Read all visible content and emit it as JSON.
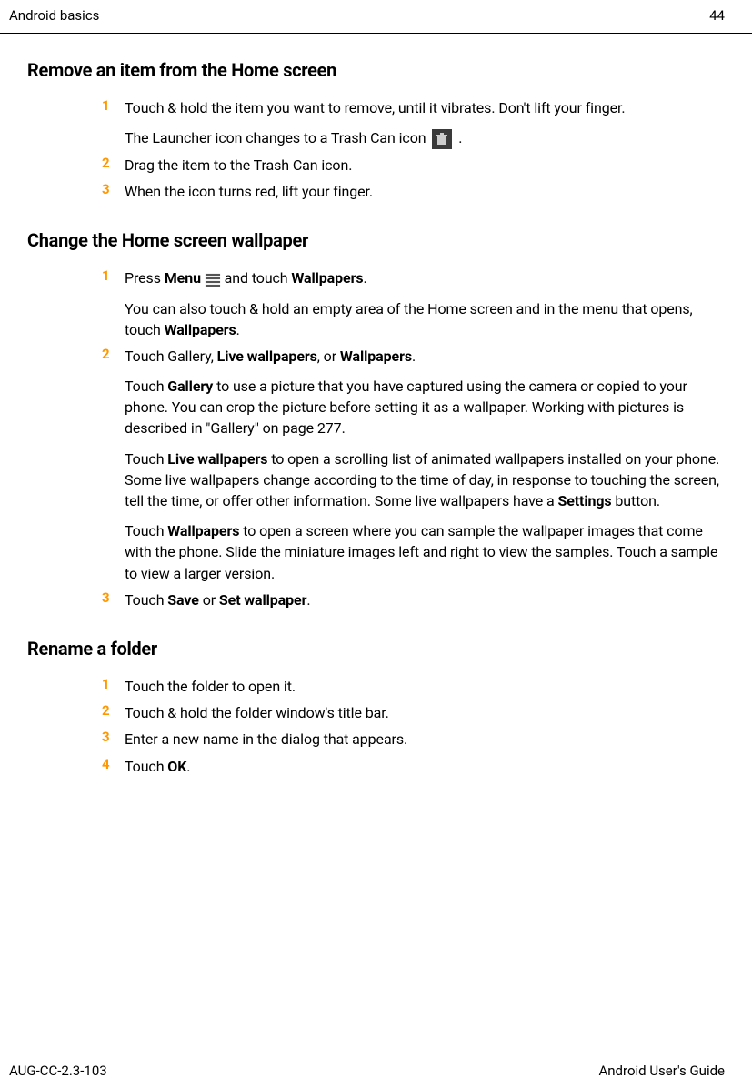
{
  "header": {
    "left": "Android basics",
    "right": "44"
  },
  "section1": {
    "title": "Remove an item from the Home screen",
    "steps": [
      {
        "num": "1",
        "line1": "Touch & hold the item you want to remove, until it vibrates. Don't lift your finger.",
        "line2a": "The Launcher icon changes to a Trash Can icon ",
        "line2b": " ."
      },
      {
        "num": "2",
        "text": "Drag the item to the Trash Can icon."
      },
      {
        "num": "3",
        "text": "When the icon turns red, lift your finger."
      }
    ]
  },
  "section2": {
    "title": "Change the Home screen wallpaper",
    "step1": {
      "num": "1",
      "p1_a": "Press ",
      "p1_b": "Menu",
      "p1_c": " ",
      "p1_d": " and touch ",
      "p1_e": "Wallpapers",
      "p1_f": ".",
      "p2_a": "You can also touch & hold an empty area of the Home screen and in the menu that opens, touch ",
      "p2_b": "Wallpapers",
      "p2_c": "."
    },
    "step2": {
      "num": "2",
      "p1_a": "Touch Gallery, ",
      "p1_b": "Live wallpapers",
      "p1_c": ", or ",
      "p1_d": "Wallpapers",
      "p1_e": ".",
      "p2_a": "Touch ",
      "p2_b": "Gallery",
      "p2_c": " to use a picture that you have captured using the camera or copied to your phone. You can crop the picture before setting it as a wallpaper. Working with pictures is described in \"Gallery\" on page 277.",
      "p3_a": "Touch ",
      "p3_b": "Live wallpapers",
      "p3_c": " to open a scrolling list of animated wallpapers installed on your phone. Some live wallpapers change according to the time of day, in response to touching the screen, tell the time, or offer other information. Some live wallpapers have a ",
      "p3_d": "Settings",
      "p3_e": " button.",
      "p4_a": "Touch ",
      "p4_b": "Wallpapers",
      "p4_c": " to open a screen where you can sample the wallpaper images that come with the phone. Slide the miniature images left and right to view the samples. Touch a sample to view a larger version."
    },
    "step3": {
      "num": "3",
      "a": "Touch ",
      "b": "Save",
      "c": " or ",
      "d": "Set wallpaper",
      "e": "."
    }
  },
  "section3": {
    "title": "Rename a folder",
    "steps": [
      {
        "num": "1",
        "text": "Touch the folder to open it."
      },
      {
        "num": "2",
        "text": "Touch & hold the folder window's title bar."
      },
      {
        "num": "3",
        "text": "Enter a new name in the dialog that appears."
      },
      {
        "num": "4",
        "a": "Touch ",
        "b": "OK",
        "c": "."
      }
    ]
  },
  "footer": {
    "left": "AUG-CC-2.3-103",
    "right": "Android User's Guide"
  }
}
